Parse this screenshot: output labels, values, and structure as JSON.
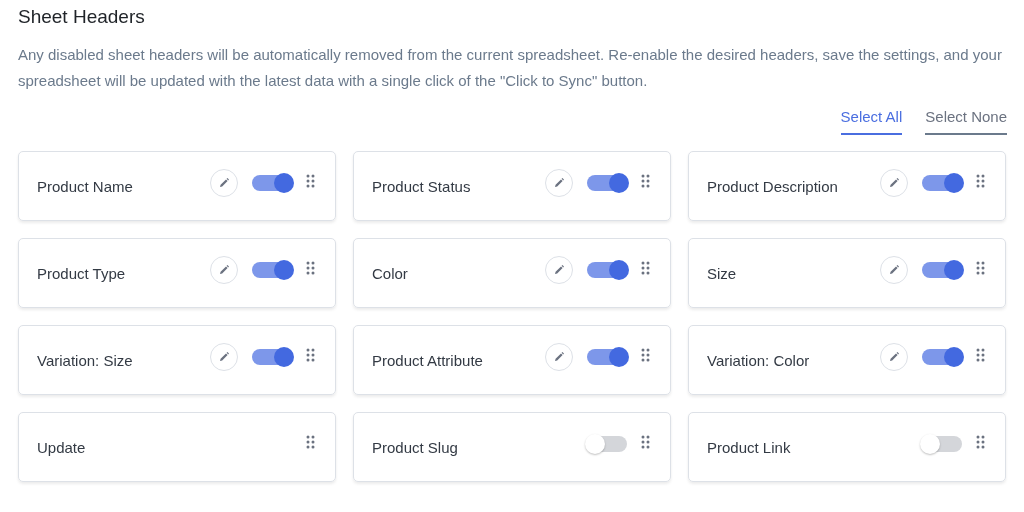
{
  "title": "Sheet Headers",
  "description": "Any disabled sheet headers will be automatically removed from the current spreadsheet. Re-enable the desired headers, save the settings, and your spreadsheet will be updated with the latest data with a single click of the \"Click to Sync\" button.",
  "actions": [
    {
      "label": "Select All",
      "selected": true
    },
    {
      "label": "Select None",
      "selected": false
    }
  ],
  "headers": [
    {
      "label": "Product Name",
      "kind": "toggle",
      "on": true,
      "editable": true
    },
    {
      "label": "Product Status",
      "kind": "toggle",
      "on": true,
      "editable": true
    },
    {
      "label": "Product Description",
      "kind": "toggle",
      "on": true,
      "editable": true
    },
    {
      "label": "Product Type",
      "kind": "toggle",
      "on": true,
      "editable": true
    },
    {
      "label": "Color",
      "kind": "toggle",
      "on": true,
      "editable": true
    },
    {
      "label": "Size",
      "kind": "toggle",
      "on": true,
      "editable": true
    },
    {
      "label": "Variation: Size",
      "kind": "toggle",
      "on": true,
      "editable": true
    },
    {
      "label": "Product Attribute",
      "kind": "toggle",
      "on": true,
      "editable": true
    },
    {
      "label": "Variation: Color",
      "kind": "toggle",
      "on": true,
      "editable": true
    },
    {
      "label": "Update",
      "kind": "plain",
      "editable": false
    },
    {
      "label": "Product Slug",
      "kind": "toggle",
      "on": false,
      "editable": false
    },
    {
      "label": "Product Link",
      "kind": "toggle",
      "on": false,
      "editable": false
    }
  ]
}
